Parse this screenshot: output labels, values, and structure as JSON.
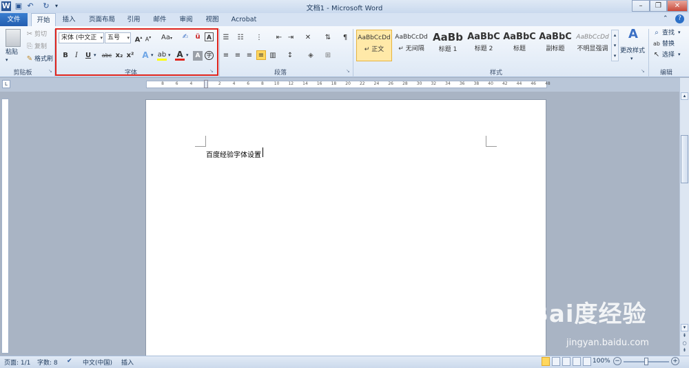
{
  "window": {
    "title": "文档1 - Microsoft Word"
  },
  "quick_access": {
    "icons": [
      "word-app-icon",
      "save-icon",
      "undo-icon",
      "redo-icon",
      "customize-icon"
    ]
  },
  "tabs": [
    "文件",
    "开始",
    "插入",
    "页面布局",
    "引用",
    "邮件",
    "审阅",
    "视图",
    "Acrobat"
  ],
  "clipboard": {
    "paste": "粘贴",
    "cut": "剪切",
    "copy": "复制",
    "format_painter": "格式刷",
    "label": "剪贴板"
  },
  "font": {
    "label": "字体",
    "font_name": "宋体 (中文正",
    "font_size": "五号",
    "grow": "A",
    "shrink": "A",
    "change_case": "Aa",
    "bold": "B",
    "italic": "I",
    "underline": "U",
    "strike": "abc",
    "sub": "x₂",
    "sup": "x²"
  },
  "paragraph": {
    "label": "段落"
  },
  "styles": {
    "label": "样式",
    "items": [
      {
        "sample": "AaBbCcDd",
        "name": "↵ 正文"
      },
      {
        "sample": "AaBbCcDd",
        "name": "↵ 无间隔"
      },
      {
        "sample": "AaBb",
        "name": "标题 1"
      },
      {
        "sample": "AaBbC",
        "name": "标题 2"
      },
      {
        "sample": "AaBbC",
        "name": "标题"
      },
      {
        "sample": "AaBbC",
        "name": "副标题"
      },
      {
        "sample": "AaBbCcDd",
        "name": "不明显强调"
      }
    ],
    "change_styles": "更改样式"
  },
  "editing": {
    "label": "编辑",
    "find": "查找",
    "replace": "替换",
    "select": "选择"
  },
  "ruler": {
    "numbers": [
      "8",
      "6",
      "4",
      "2",
      "2",
      "4",
      "6",
      "8",
      "10",
      "12",
      "14",
      "16",
      "18",
      "20",
      "22",
      "24",
      "26",
      "28",
      "30",
      "32",
      "34",
      "36",
      "38",
      "40",
      "42",
      "44",
      "46",
      "48"
    ]
  },
  "document": {
    "text": "百度经验字体设置"
  },
  "status": {
    "page": "页面: 1/1",
    "words": "字数: 8",
    "lang": "中文(中国)",
    "mode": "插入",
    "zoom": "100%"
  },
  "watermark": {
    "logo": "Bai度经验",
    "url": "jingyan.baidu.com"
  }
}
